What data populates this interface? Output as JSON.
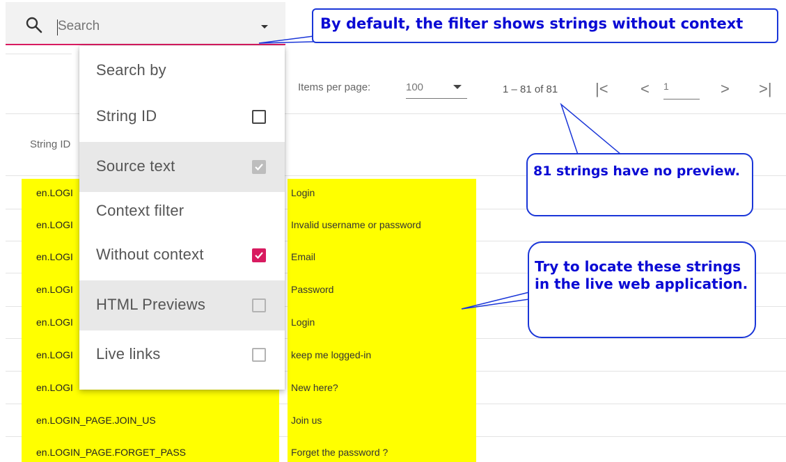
{
  "search": {
    "placeholder": "Search",
    "icon": "search-icon"
  },
  "paginator": {
    "items_per_page_label": "Items per page:",
    "items_per_page_value": "100",
    "range_label": "1 – 81 of 81",
    "first_page_glyph": "|<",
    "prev_page_glyph": "<",
    "page_value": "1",
    "next_page_glyph": ">",
    "last_page_glyph": ">|"
  },
  "table": {
    "header_string_id": "String ID",
    "rows": [
      {
        "id": "en.LOGI",
        "source": "Login"
      },
      {
        "id": "en.LOGI",
        "source": "Invalid username or password"
      },
      {
        "id": "en.LOGI",
        "source": "Email"
      },
      {
        "id": "en.LOGI",
        "source": "Password"
      },
      {
        "id": "en.LOGI",
        "source": "Login"
      },
      {
        "id": "en.LOGI",
        "source": "keep me logged-in"
      },
      {
        "id": "en.LOGI",
        "source": "New here?"
      },
      {
        "id": "en.LOGIN_PAGE.JOIN_US",
        "source": "Join us"
      },
      {
        "id": "en.LOGIN_PAGE.FORGET_PASS",
        "source": "Forget the password ?"
      }
    ]
  },
  "dropdown": {
    "search_by_title": "Search by",
    "string_id": "String ID",
    "source_text": "Source text",
    "context_filter_title": "Context filter",
    "without_context": "Without context",
    "html_previews": "HTML Previews",
    "live_links": "Live links"
  },
  "callouts": {
    "top": "By default, the filter shows strings without context",
    "mid": "81 strings have no preview.",
    "low": "Try to locate these strings in the live web application."
  },
  "colors": {
    "accent": "#d81b60",
    "highlight": "#ffff00",
    "callout_text": "#0a0ad4",
    "callout_border": "#1a36d8"
  }
}
